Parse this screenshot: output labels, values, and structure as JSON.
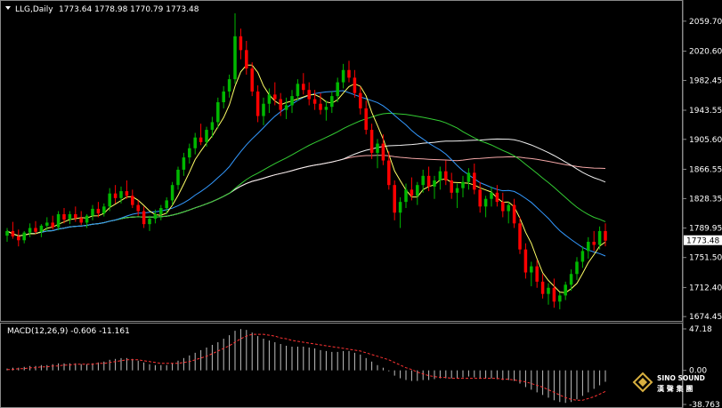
{
  "window": {
    "symbol_label": "LLG,Daily",
    "ohlc_text": "1773.64 1778.98 1770.79 1773.48"
  },
  "price_axis": {
    "ticks": [
      "2059.70",
      "2020.60",
      "1982.45",
      "1943.55",
      "1905.60",
      "1866.55",
      "1828.35",
      "1789.95",
      "1751.50",
      "1712.40",
      "1674.45"
    ],
    "current_price": "1773.48",
    "ylim": [
      1670,
      2085
    ]
  },
  "macd": {
    "label": "MACD(12,26,9) -0.606 -11.161",
    "ticks": [
      "47.18",
      "0.00",
      "-38.763"
    ],
    "ylim": [
      -38.763,
      47.18
    ]
  },
  "logo": {
    "name": "SINO SOUND",
    "chinese": "漢 聲 集 團"
  },
  "colors": {
    "background": "#000000",
    "bull": "#00b800",
    "bear": "#ff0000",
    "ma_fast": "#ffff66",
    "ma_mid": "#3399ff",
    "ma_slow": "#33cc33",
    "ma_long": "#f0f0f0",
    "ma_extra": "#f4a7a7",
    "macd_hist": "#c0c0c0",
    "macd_signal": "#ff3333"
  },
  "chart_data": {
    "type": "candlestick",
    "timeframe": "Daily",
    "candles": [
      [
        1780,
        1790,
        1772,
        1786
      ],
      [
        1786,
        1798,
        1776,
        1779
      ],
      [
        1779,
        1788,
        1766,
        1774
      ],
      [
        1774,
        1786,
        1770,
        1784
      ],
      [
        1784,
        1796,
        1778,
        1790
      ],
      [
        1790,
        1799,
        1782,
        1785
      ],
      [
        1785,
        1795,
        1778,
        1793
      ],
      [
        1793,
        1804,
        1786,
        1797
      ],
      [
        1797,
        1806,
        1788,
        1791
      ],
      [
        1791,
        1812,
        1787,
        1808
      ],
      [
        1808,
        1816,
        1796,
        1801
      ],
      [
        1801,
        1812,
        1795,
        1808
      ],
      [
        1808,
        1818,
        1798,
        1803
      ],
      [
        1803,
        1812,
        1794,
        1797
      ],
      [
        1797,
        1808,
        1790,
        1806
      ],
      [
        1806,
        1820,
        1800,
        1815
      ],
      [
        1815,
        1824,
        1804,
        1809
      ],
      [
        1809,
        1822,
        1805,
        1818
      ],
      [
        1818,
        1842,
        1812,
        1835
      ],
      [
        1835,
        1846,
        1822,
        1829
      ],
      [
        1829,
        1844,
        1822,
        1838
      ],
      [
        1838,
        1852,
        1828,
        1832
      ],
      [
        1832,
        1840,
        1816,
        1820
      ],
      [
        1820,
        1826,
        1806,
        1812
      ],
      [
        1812,
        1818,
        1790,
        1795
      ],
      [
        1795,
        1806,
        1786,
        1802
      ],
      [
        1802,
        1814,
        1796,
        1808
      ],
      [
        1808,
        1820,
        1800,
        1816
      ],
      [
        1816,
        1830,
        1808,
        1826
      ],
      [
        1826,
        1850,
        1820,
        1846
      ],
      [
        1846,
        1870,
        1840,
        1866
      ],
      [
        1866,
        1888,
        1858,
        1882
      ],
      [
        1882,
        1900,
        1874,
        1894
      ],
      [
        1894,
        1914,
        1886,
        1908
      ],
      [
        1908,
        1926,
        1898,
        1902
      ],
      [
        1902,
        1922,
        1896,
        1918
      ],
      [
        1918,
        1935,
        1908,
        1928
      ],
      [
        1928,
        1960,
        1920,
        1954
      ],
      [
        1954,
        1975,
        1946,
        1968
      ],
      [
        1968,
        1990,
        1960,
        1984
      ],
      [
        1984,
        2070,
        1978,
        2040
      ],
      [
        2040,
        2050,
        2010,
        2022
      ],
      [
        2022,
        2034,
        1990,
        1998
      ],
      [
        1998,
        2006,
        1962,
        1968
      ],
      [
        1968,
        1976,
        1928,
        1936
      ],
      [
        1936,
        1960,
        1924,
        1952
      ],
      [
        1952,
        1972,
        1940,
        1964
      ],
      [
        1964,
        1980,
        1950,
        1958
      ],
      [
        1958,
        1966,
        1936,
        1944
      ],
      [
        1944,
        1960,
        1932,
        1950
      ],
      [
        1950,
        1970,
        1940,
        1962
      ],
      [
        1962,
        1984,
        1956,
        1978
      ],
      [
        1978,
        1992,
        1964,
        1970
      ],
      [
        1970,
        1980,
        1950,
        1958
      ],
      [
        1958,
        1970,
        1944,
        1952
      ],
      [
        1952,
        1966,
        1938,
        1944
      ],
      [
        1944,
        1956,
        1930,
        1948
      ],
      [
        1948,
        1968,
        1940,
        1962
      ],
      [
        1962,
        1986,
        1954,
        1980
      ],
      [
        1980,
        2004,
        1972,
        1996
      ],
      [
        1996,
        2008,
        1980,
        1986
      ],
      [
        1986,
        1996,
        1960,
        1966
      ],
      [
        1966,
        1974,
        1938,
        1946
      ],
      [
        1946,
        1956,
        1912,
        1918
      ],
      [
        1918,
        1926,
        1880,
        1888
      ],
      [
        1888,
        1906,
        1868,
        1900
      ],
      [
        1900,
        1912,
        1872,
        1878
      ],
      [
        1878,
        1890,
        1840,
        1846
      ],
      [
        1846,
        1852,
        1800,
        1810
      ],
      [
        1810,
        1830,
        1790,
        1824
      ],
      [
        1824,
        1848,
        1816,
        1840
      ],
      [
        1840,
        1856,
        1826,
        1832
      ],
      [
        1832,
        1850,
        1820,
        1846
      ],
      [
        1846,
        1866,
        1836,
        1858
      ],
      [
        1858,
        1870,
        1838,
        1844
      ],
      [
        1844,
        1858,
        1828,
        1852
      ],
      [
        1852,
        1870,
        1840,
        1864
      ],
      [
        1864,
        1878,
        1846,
        1852
      ],
      [
        1852,
        1862,
        1828,
        1836
      ],
      [
        1836,
        1848,
        1816,
        1842
      ],
      [
        1842,
        1858,
        1830,
        1850
      ],
      [
        1850,
        1868,
        1840,
        1862
      ],
      [
        1862,
        1874,
        1834,
        1840
      ],
      [
        1840,
        1850,
        1810,
        1818
      ],
      [
        1818,
        1832,
        1804,
        1828
      ],
      [
        1828,
        1844,
        1818,
        1836
      ],
      [
        1836,
        1846,
        1818,
        1824
      ],
      [
        1824,
        1836,
        1804,
        1812
      ],
      [
        1812,
        1824,
        1796,
        1820
      ],
      [
        1820,
        1828,
        1790,
        1796
      ],
      [
        1796,
        1804,
        1756,
        1762
      ],
      [
        1762,
        1770,
        1724,
        1732
      ],
      [
        1732,
        1746,
        1714,
        1740
      ],
      [
        1740,
        1748,
        1712,
        1720
      ],
      [
        1720,
        1730,
        1698,
        1704
      ],
      [
        1704,
        1718,
        1690,
        1712
      ],
      [
        1712,
        1724,
        1686,
        1694
      ],
      [
        1694,
        1706,
        1684,
        1702
      ],
      [
        1702,
        1720,
        1696,
        1716
      ],
      [
        1716,
        1736,
        1708,
        1730
      ],
      [
        1730,
        1752,
        1722,
        1746
      ],
      [
        1746,
        1766,
        1738,
        1760
      ],
      [
        1760,
        1778,
        1750,
        1772
      ],
      [
        1772,
        1786,
        1760,
        1768
      ],
      [
        1768,
        1792,
        1762,
        1786
      ],
      [
        1786,
        1796,
        1766,
        1773.48
      ]
    ],
    "macd_histogram": [
      2,
      3,
      3,
      4,
      5,
      5,
      6,
      6,
      7,
      8,
      8,
      8,
      8,
      7,
      7,
      8,
      9,
      10,
      12,
      13,
      14,
      14,
      13,
      11,
      9,
      7,
      6,
      6,
      6,
      8,
      11,
      14,
      17,
      20,
      23,
      26,
      29,
      32,
      36,
      40,
      45,
      47,
      46,
      43,
      39,
      36,
      34,
      32,
      30,
      28,
      27,
      27,
      27,
      26,
      25,
      23,
      22,
      21,
      21,
      22,
      22,
      20,
      18,
      14,
      10,
      6,
      3,
      -1,
      -6,
      -9,
      -11,
      -12,
      -12,
      -11,
      -11,
      -10,
      -9,
      -9,
      -9,
      -9,
      -8,
      -7,
      -8,
      -9,
      -9,
      -9,
      -10,
      -11,
      -11,
      -12,
      -15,
      -19,
      -22,
      -25,
      -28,
      -31,
      -34,
      -36,
      -37,
      -36,
      -33,
      -29,
      -25,
      -21,
      -17,
      -13
    ],
    "macd_signal": [
      1,
      1,
      2,
      2,
      3,
      3,
      4,
      4,
      5,
      5,
      6,
      6,
      7,
      7,
      7,
      7,
      8,
      8,
      9,
      10,
      11,
      12,
      12,
      12,
      11,
      10,
      9,
      8,
      8,
      8,
      8,
      9,
      10,
      12,
      14,
      16,
      19,
      22,
      25,
      28,
      32,
      36,
      39,
      41,
      41,
      41,
      40,
      39,
      37,
      36,
      34,
      33,
      32,
      31,
      30,
      29,
      28,
      27,
      26,
      25,
      24,
      23,
      22,
      20,
      18,
      16,
      14,
      12,
      9,
      6,
      3,
      1,
      -2,
      -4,
      -6,
      -7,
      -8,
      -8,
      -9,
      -9,
      -9,
      -9,
      -9,
      -9,
      -9,
      -9,
      -9,
      -10,
      -10,
      -11,
      -12,
      -13,
      -15,
      -17,
      -19,
      -22,
      -25,
      -28,
      -31,
      -33,
      -34,
      -34,
      -32,
      -30,
      -27,
      -24
    ]
  }
}
